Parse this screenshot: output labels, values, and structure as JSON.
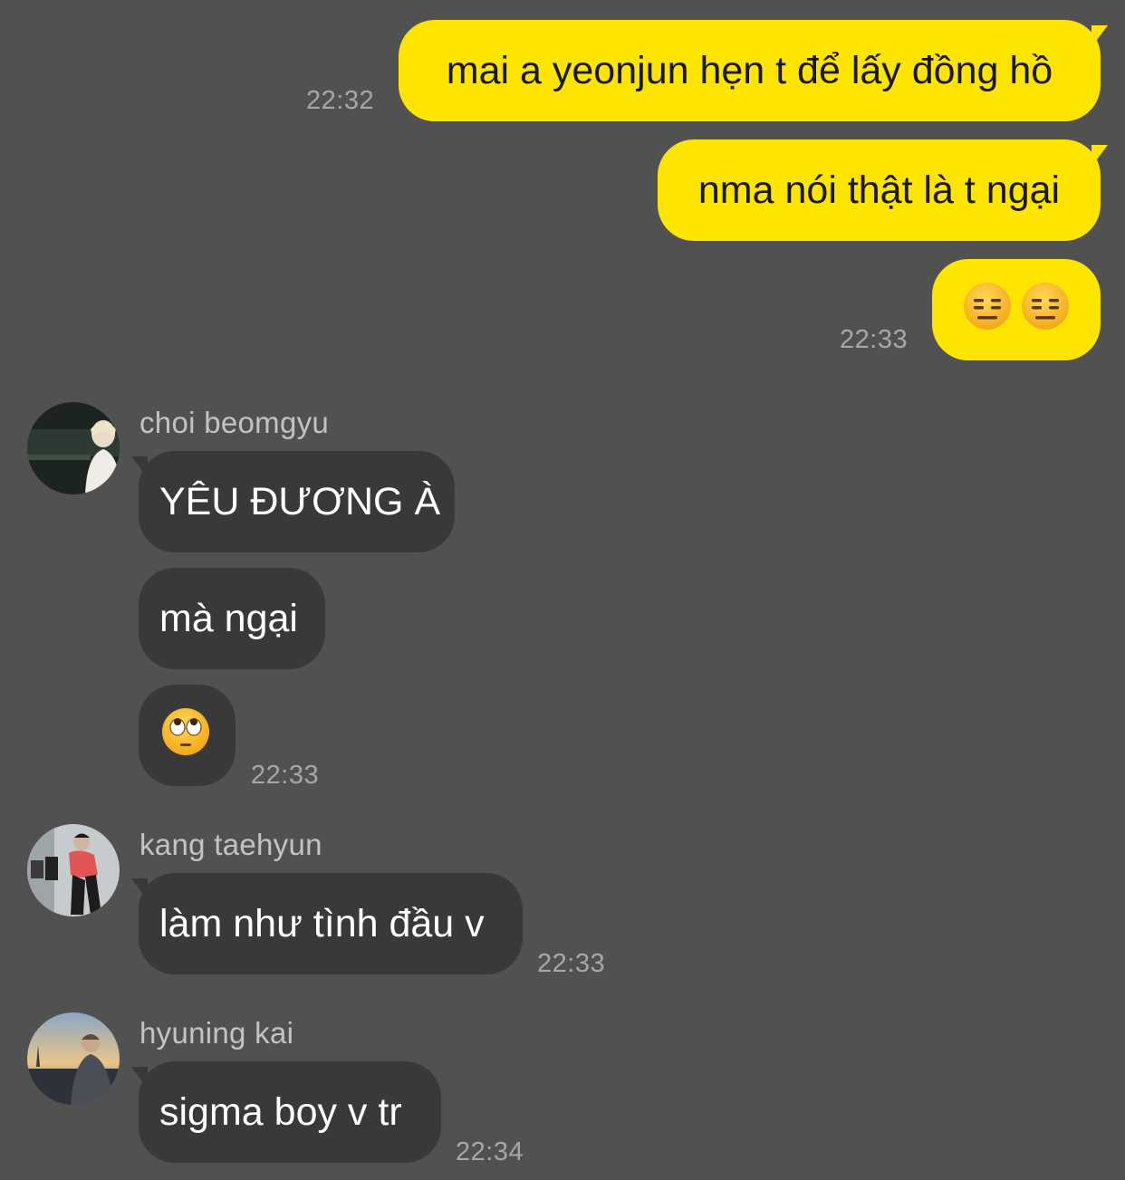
{
  "messages_out": [
    {
      "text": "mai a yeonjun hẹn t để lấy đồng hồ",
      "time": "22:32"
    },
    {
      "text": "nma nói thật là t ngại"
    },
    {
      "emoji": "expressionless-face",
      "count": 2,
      "time": "22:33"
    }
  ],
  "groups": [
    {
      "sender": "choi beomgyu",
      "avatar": "beomgyu-avatar",
      "messages": [
        {
          "text": "YÊU ĐƯƠNG À"
        },
        {
          "text": "mà ngại"
        },
        {
          "emoji": "face-with-rolling-eyes"
        }
      ],
      "time": "22:33"
    },
    {
      "sender": "kang taehyun",
      "avatar": "taehyun-avatar",
      "messages": [
        {
          "text": "làm như tình đầu v"
        }
      ],
      "time": "22:33"
    },
    {
      "sender": "hyuning kai",
      "avatar": "hyuning-kai-avatar",
      "messages": [
        {
          "text": "sigma boy v tr"
        }
      ],
      "time": "22:34"
    }
  ],
  "colors": {
    "background": "#525152",
    "outgoing_bubble": "#fee500",
    "incoming_bubble": "#3a393a",
    "timestamp": "#a8a7a8"
  }
}
